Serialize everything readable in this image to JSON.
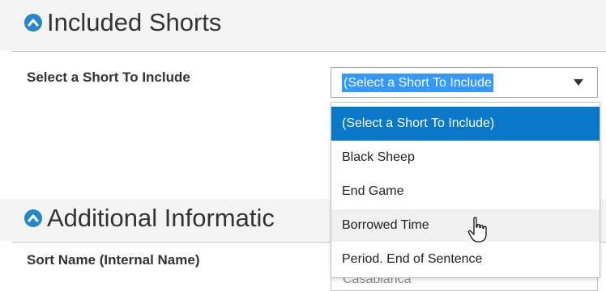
{
  "included_shorts": {
    "title": "Included Shorts",
    "field_label": "Select a Short To Include",
    "select_value": "(Select a Short To Include",
    "options": [
      "(Select a Short To Include)",
      "Black Sheep",
      "End Game",
      "Borrowed Time",
      "Period. End of Sentence"
    ],
    "hovered_option": "Borrowed Time"
  },
  "additional_information": {
    "title": "Additional Informatic",
    "field_label": "Sort Name (Internal Name)",
    "sort_name_value": "Casablanca"
  },
  "colors": {
    "accent": "#2387c9",
    "selected_option_bg": "#0a78c8",
    "text_highlight_bg": "#3399ff",
    "section_band_bg": "#f4f4f4"
  },
  "icons": {
    "section_toggle": "chevron-up-circle-icon",
    "dropdown_arrow": "caret-down-icon",
    "pointer": "hand-pointer-cursor-icon"
  }
}
